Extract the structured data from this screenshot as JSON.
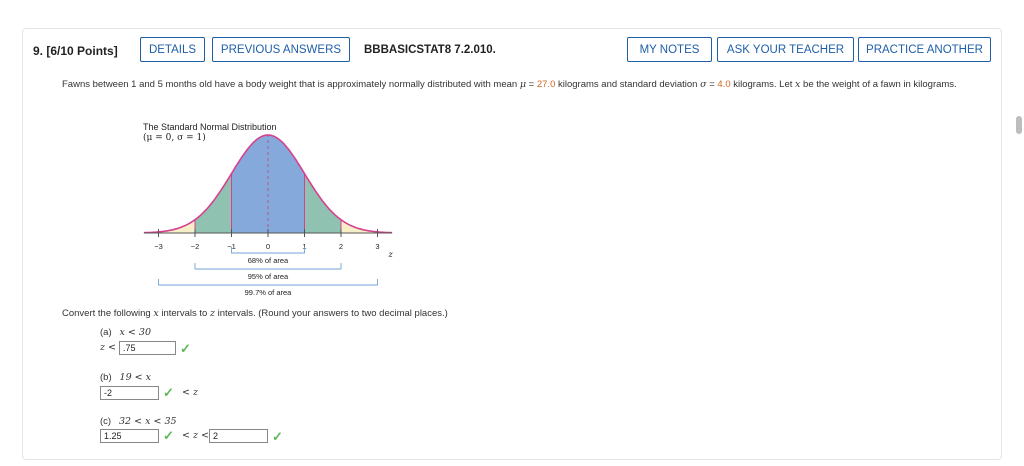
{
  "question": {
    "number": "9.",
    "points": "[6/10 Points]",
    "code": "BBBASICSTAT8 7.2.010."
  },
  "buttons": {
    "details": "DETAILS",
    "previous_answers": "PREVIOUS ANSWERS",
    "my_notes": "MY NOTES",
    "ask_teacher": "ASK YOUR TEACHER",
    "practice_another": "PRACTICE ANOTHER"
  },
  "problem": {
    "text1": "Fawns between 1 and 5 months old have a body weight that is approximately normally distributed with mean ",
    "mu_symbol": "μ",
    "mean_eq": " = ",
    "mean_value": "27.0",
    "text2": " kilograms and standard deviation ",
    "sigma_symbol": "σ",
    "sd_eq": " = ",
    "sd_value": "4.0",
    "text3": " kilograms. Let ",
    "var": "x",
    "text4": " be the weight of a fawn in kilograms."
  },
  "figure": {
    "title": "The Standard Normal Distribution",
    "params": "(μ = 0, σ = 1)",
    "ticks": [
      "−3",
      "−2",
      "−1",
      "0",
      "1",
      "2",
      "3"
    ],
    "axis_var": "z",
    "bracket_68": "68% of area",
    "bracket_95": "95% of area",
    "bracket_997": "99.7% of area",
    "colors": {
      "curve": "#d6408f",
      "center": "#86a9dc",
      "middle": "#8fc2b0",
      "tail": "#f6eec6",
      "bracket": "#6fa6d6"
    }
  },
  "instructions": {
    "text1": "Convert the following ",
    "var": "x",
    "text2": " intervals to ",
    "var2": "z",
    "text3": " intervals. (Round your answers to two decimal places.)"
  },
  "parts": {
    "a": {
      "label": "(a)",
      "interval": "x < 30",
      "prefix": "z <",
      "answer": ".75"
    },
    "b": {
      "label": "(b)",
      "interval": "19 < x",
      "answer": "-2",
      "suffix": "< z"
    },
    "c": {
      "label": "(c)",
      "interval": "32 < x < 35",
      "answer1": "1.25",
      "middle": "< z <",
      "answer2": "2"
    }
  },
  "icons": {
    "check": "check-icon",
    "scroll": "scrollbar-thumb"
  }
}
